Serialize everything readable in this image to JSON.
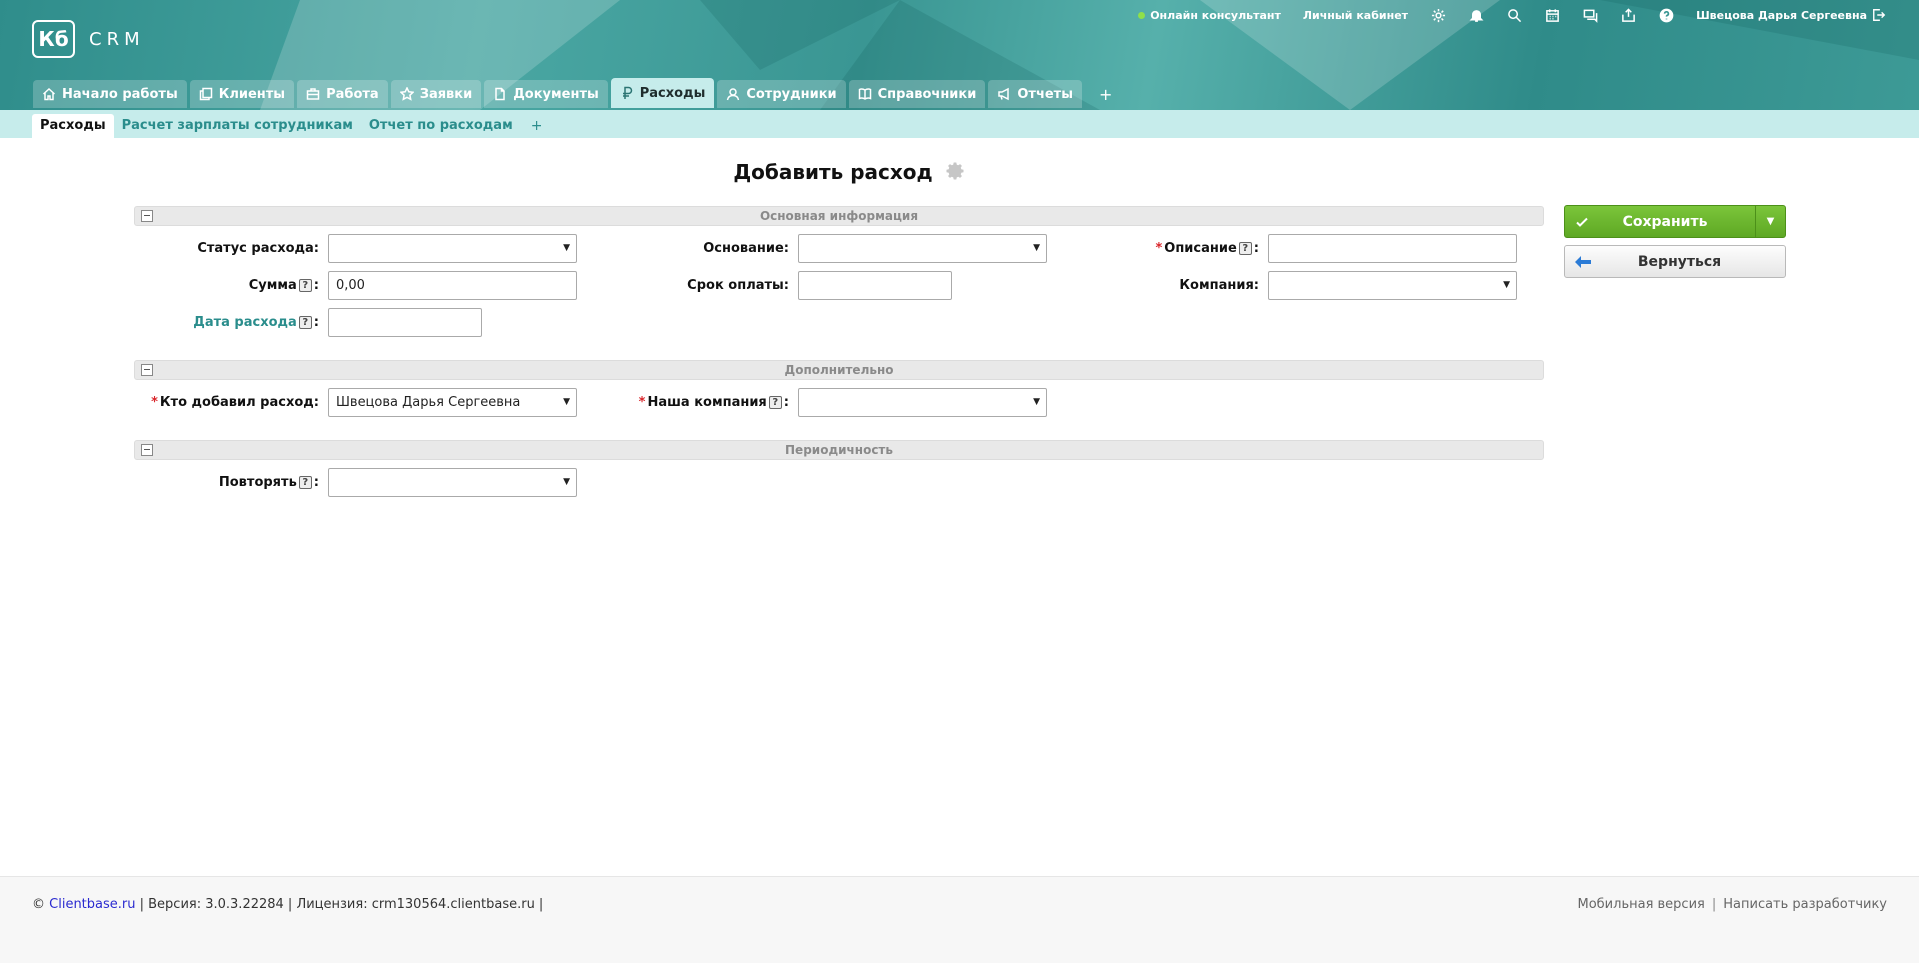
{
  "app": {
    "logo_text": "Кб",
    "logo_caption": "CRM"
  },
  "topbar": {
    "online_consultant": "Онлайн консультант",
    "personal_cabinet": "Личный кабинет",
    "icons": [
      "gear-icon",
      "bell-icon",
      "search-icon",
      "calendar-icon",
      "chat-icon",
      "export-icon",
      "help-icon"
    ],
    "user_name": "Швецова Дарья Сергеевна"
  },
  "tabs": [
    {
      "label": "Начало работы",
      "icon": "home-icon"
    },
    {
      "label": "Клиенты",
      "icon": "copy-icon"
    },
    {
      "label": "Работа",
      "icon": "briefcase-icon"
    },
    {
      "label": "Заявки",
      "icon": "star-icon"
    },
    {
      "label": "Документы",
      "icon": "document-icon"
    },
    {
      "label": "Расходы",
      "icon": "ruble-icon",
      "active": true
    },
    {
      "label": "Сотрудники",
      "icon": "users-icon"
    },
    {
      "label": "Справочники",
      "icon": "book-icon"
    },
    {
      "label": "Отчеты",
      "icon": "megaphone-icon"
    }
  ],
  "tab_add": "+",
  "subtabs": [
    {
      "label": "Расходы",
      "active": true
    },
    {
      "label": "Расчет зарплаты сотрудникам"
    },
    {
      "label": "Отчет по расходам"
    }
  ],
  "subtab_add": "+",
  "page": {
    "title": "Добавить расход"
  },
  "sections": {
    "main": {
      "title": "Основная информация",
      "status_label": "Статус расхода:",
      "status_value": "",
      "basis_label": "Основание:",
      "basis_value": "",
      "description_label": "Описание",
      "description_value": "",
      "sum_label": "Сумма",
      "sum_value": "0,00",
      "due_label": "Срок оплаты:",
      "due_value": "",
      "company_label": "Компания:",
      "company_value": "",
      "date_label": "Дата расхода",
      "date_value": ""
    },
    "extra": {
      "title": "Дополнительно",
      "added_by_label": "Кто добавил расход:",
      "added_by_value": "Швецова Дарья Сергеевна",
      "our_company_label": "Наша компания",
      "our_company_value": ""
    },
    "periodicity": {
      "title": "Периодичность",
      "repeat_label": "Повторять",
      "repeat_value": ""
    }
  },
  "help_mark": "?",
  "required_mark": "*",
  "colon": ":",
  "buttons": {
    "save": "Сохранить",
    "back": "Вернуться"
  },
  "footer": {
    "copyright": "©",
    "site_link": "Clientbase.ru",
    "version": "| Версия: 3.0.3.22284 | Лицензия: crm130564.clientbase.ru |",
    "mobile": "Мобильная версия",
    "separator": "|",
    "contact_dev": "Написать разработчику"
  }
}
